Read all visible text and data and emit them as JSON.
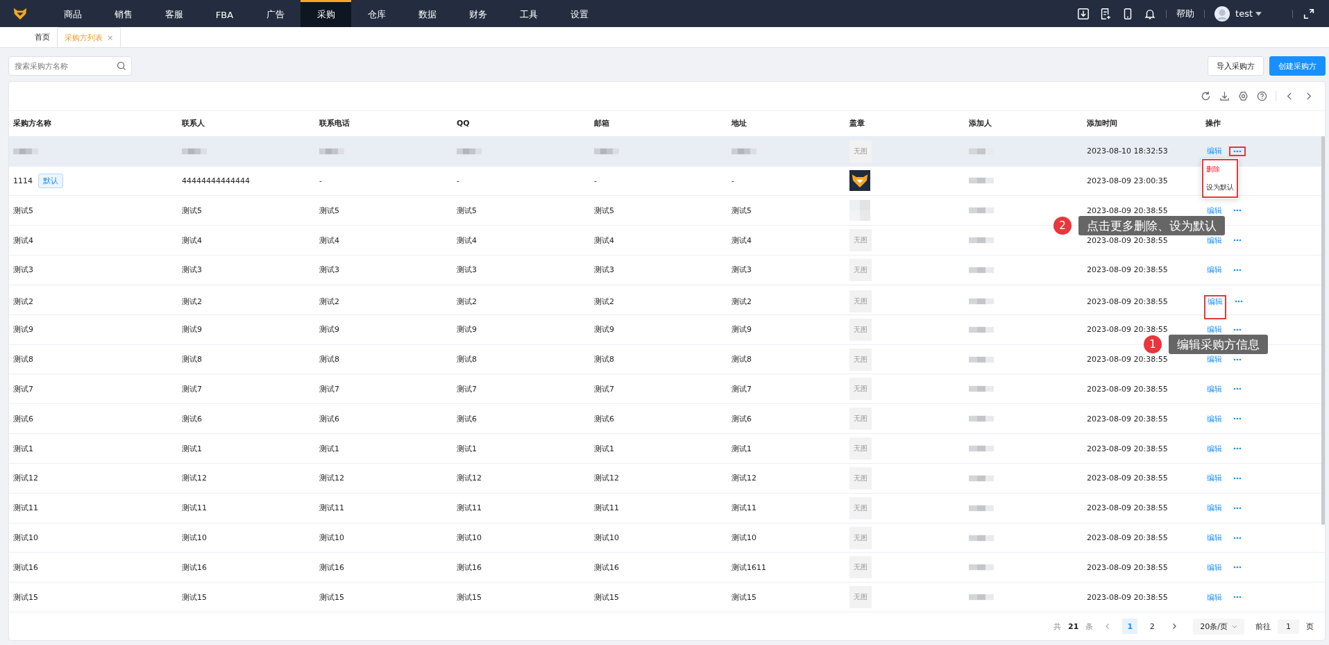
{
  "nav": {
    "items": [
      {
        "label": "商品",
        "selected": false
      },
      {
        "label": "销售",
        "selected": false
      },
      {
        "label": "客服",
        "selected": false
      },
      {
        "label": "FBA",
        "selected": false
      },
      {
        "label": "广告",
        "selected": false
      },
      {
        "label": "采购",
        "selected": true
      },
      {
        "label": "仓库",
        "selected": false
      },
      {
        "label": "数据",
        "selected": false
      },
      {
        "label": "财务",
        "selected": false
      },
      {
        "label": "工具",
        "selected": false
      },
      {
        "label": "设置",
        "selected": false
      }
    ],
    "help": "帮助",
    "user": "test"
  },
  "tabs": [
    {
      "label": "首页",
      "selected": false,
      "closable": false
    },
    {
      "label": "采购方列表",
      "selected": true,
      "closable": true,
      "close": "×"
    }
  ],
  "search": {
    "placeholder": "搜索采购方名称"
  },
  "buttons": [
    {
      "label": "导入采购方",
      "kind": "default"
    },
    {
      "label": "创建采购方",
      "kind": "primary"
    }
  ],
  "table": {
    "columns": [
      "采购方名称",
      "联系人",
      "联系电话",
      "QQ",
      "邮箱",
      "地址",
      "盖章",
      "添加人",
      "添加时间",
      "操作"
    ],
    "rows": [
      {
        "selected": true,
        "blurred": true,
        "stamp": {
          "kind": "none",
          "text": "无图"
        },
        "time": "2023-08-10 18:32:53",
        "edit": "编辑",
        "edit_highlighted": false,
        "more_highlighted": true
      },
      {
        "selected": false,
        "blurred": false,
        "cells": [
          "1114",
          "44444444444444",
          "-",
          "-",
          "-",
          "-"
        ],
        "badge": "默认",
        "stamp": {
          "kind": "logo"
        },
        "time": "2023-08-09 23:00:35"
      },
      {
        "selected": false,
        "blurred": false,
        "cells": [
          "测试5",
          "测试5",
          "测试5",
          "测试5",
          "测试5",
          "测试5"
        ],
        "stamp": {
          "kind": "blur"
        },
        "time": "2023-08-09 20:38:55",
        "edit": "编辑",
        "edit_highlighted": false,
        "more_highlighted": false
      },
      {
        "selected": false,
        "blurred": false,
        "cells": [
          "测试4",
          "测试4",
          "测试4",
          "测试4",
          "测试4",
          "测试4"
        ],
        "stamp": {
          "kind": "none",
          "text": "无图"
        },
        "time": "2023-08-09 20:38:55",
        "edit": "编辑",
        "edit_highlighted": false,
        "more_highlighted": false
      },
      {
        "selected": false,
        "blurred": false,
        "cells": [
          "测试3",
          "测试3",
          "测试3",
          "测试3",
          "测试3",
          "测试3"
        ],
        "stamp": {
          "kind": "none",
          "text": "无图"
        },
        "time": "2023-08-09 20:38:55",
        "edit": "编辑",
        "edit_highlighted": false,
        "more_highlighted": false
      },
      {
        "selected": false,
        "blurred": false,
        "cells": [
          "测试2",
          "测试2",
          "测试2",
          "测试2",
          "测试2",
          "测试2"
        ],
        "stamp": {
          "kind": "none",
          "text": "无图"
        },
        "time": "2023-08-09 20:38:55",
        "edit": "编辑",
        "edit_highlighted": true,
        "more_highlighted": false
      },
      {
        "selected": false,
        "blurred": false,
        "cells": [
          "测试9",
          "测试9",
          "测试9",
          "测试9",
          "测试9",
          "测试9"
        ],
        "stamp": {
          "kind": "none",
          "text": "无图"
        },
        "time": "2023-08-09 20:38:55",
        "edit": "编辑",
        "edit_highlighted": false,
        "more_highlighted": false
      },
      {
        "selected": false,
        "blurred": false,
        "cells": [
          "测试8",
          "测试8",
          "测试8",
          "测试8",
          "测试8",
          "测试8"
        ],
        "stamp": {
          "kind": "none",
          "text": "无图"
        },
        "time": "2023-08-09 20:38:55",
        "edit": "编辑",
        "edit_highlighted": false,
        "more_highlighted": false
      },
      {
        "selected": false,
        "blurred": false,
        "cells": [
          "测试7",
          "测试7",
          "测试7",
          "测试7",
          "测试7",
          "测试7"
        ],
        "stamp": {
          "kind": "none",
          "text": "无图"
        },
        "time": "2023-08-09 20:38:55",
        "edit": "编辑",
        "edit_highlighted": false,
        "more_highlighted": false
      },
      {
        "selected": false,
        "blurred": false,
        "cells": [
          "测试6",
          "测试6",
          "测试6",
          "测试6",
          "测试6",
          "测试6"
        ],
        "stamp": {
          "kind": "none",
          "text": "无图"
        },
        "time": "2023-08-09 20:38:55",
        "edit": "编辑",
        "edit_highlighted": false,
        "more_highlighted": false
      },
      {
        "selected": false,
        "blurred": false,
        "cells": [
          "测试1",
          "测试1",
          "测试1",
          "测试1",
          "测试1",
          "测试1"
        ],
        "stamp": {
          "kind": "none",
          "text": "无图"
        },
        "time": "2023-08-09 20:38:55",
        "edit": "编辑",
        "edit_highlighted": false,
        "more_highlighted": false
      },
      {
        "selected": false,
        "blurred": false,
        "cells": [
          "测试12",
          "测试12",
          "测试12",
          "测试12",
          "测试12",
          "测试12"
        ],
        "stamp": {
          "kind": "none",
          "text": "无图"
        },
        "time": "2023-08-09 20:38:55",
        "edit": "编辑",
        "edit_highlighted": false,
        "more_highlighted": false
      },
      {
        "selected": false,
        "blurred": false,
        "cells": [
          "测试11",
          "测试11",
          "测试11",
          "测试11",
          "测试11",
          "测试11"
        ],
        "stamp": {
          "kind": "none",
          "text": "无图"
        },
        "time": "2023-08-09 20:38:55",
        "edit": "编辑",
        "edit_highlighted": false,
        "more_highlighted": false
      },
      {
        "selected": false,
        "blurred": false,
        "cells": [
          "测试10",
          "测试10",
          "测试10",
          "测试10",
          "测试10",
          "测试10"
        ],
        "stamp": {
          "kind": "none",
          "text": "无图"
        },
        "time": "2023-08-09 20:38:55",
        "edit": "编辑",
        "edit_highlighted": false,
        "more_highlighted": false
      },
      {
        "selected": false,
        "blurred": false,
        "cells": [
          "测试16",
          "测试16",
          "测试16",
          "测试16",
          "测试16",
          "测试1611"
        ],
        "stamp": {
          "kind": "none",
          "text": "无图"
        },
        "time": "2023-08-09 20:38:55",
        "edit": "编辑",
        "edit_highlighted": false,
        "more_highlighted": false
      },
      {
        "selected": false,
        "blurred": false,
        "cells": [
          "测试15",
          "测试15",
          "测试15",
          "测试15",
          "测试15",
          "测试15"
        ],
        "stamp": {
          "kind": "none",
          "text": "无图"
        },
        "time": "2023-08-09 20:38:55",
        "edit": "编辑",
        "edit_highlighted": false,
        "more_highlighted": false
      }
    ]
  },
  "dropdown": {
    "items": [
      {
        "label": "删除",
        "kind": "danger"
      },
      {
        "label": "设为默认",
        "kind": "normal"
      }
    ]
  },
  "callouts": [
    {
      "number": "2",
      "text": "点击更多删除、设为默认"
    },
    {
      "number": "1",
      "text": "编辑采购方信息"
    }
  ],
  "pagination": {
    "total_prefix": "共",
    "total": "21",
    "total_suffix": "条",
    "pages": [
      {
        "label": "1",
        "selected": true
      },
      {
        "label": "2",
        "selected": false
      }
    ],
    "page_size": "20条/页",
    "goto": "前往",
    "goto_value": "1",
    "goto_suffix": "页"
  }
}
